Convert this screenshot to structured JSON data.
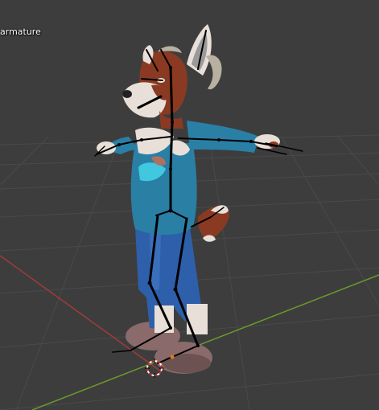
{
  "viewport": {
    "object_label": "armature",
    "background_color": "#3d3d3d",
    "grid_line_color": "#4a4a4a",
    "x_axis_color": "#a33a3a",
    "y_axis_color": "#6b9a2a",
    "bone_color": "#000000",
    "origin_marker_color": "#e07a20"
  },
  "character": {
    "fur_color": "#8a3a22",
    "fur_light_color": "#e8e0d8",
    "hoodie_color": "#2a7fa5",
    "jeans_color": "#2e5faa",
    "shoe_color": "#8a6a6a",
    "horn_color": "#b8b0a0",
    "ear_inner_color": "#9a9a9a"
  }
}
